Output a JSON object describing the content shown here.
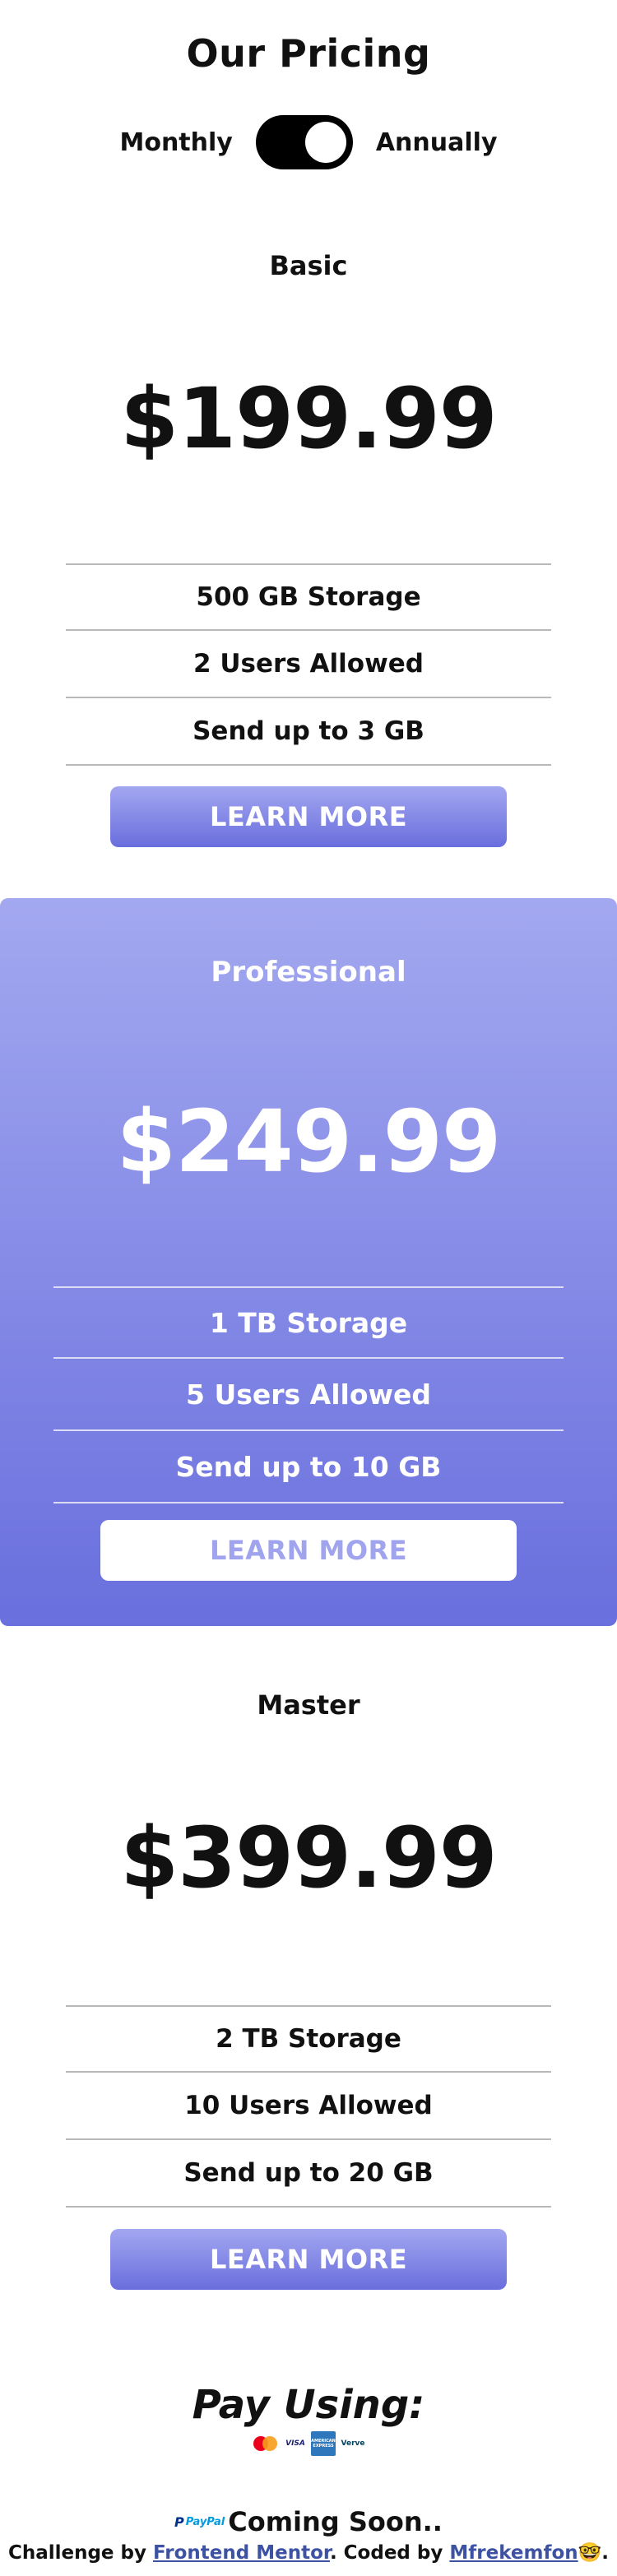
{
  "header": {
    "title": "Our Pricing",
    "toggle": {
      "left_label": "Monthly",
      "right_label": "Annually",
      "state": "annually"
    }
  },
  "plans": [
    {
      "name": "Basic",
      "price": "$199.99",
      "features": [
        "500 GB Storage",
        "2 Users Allowed",
        "Send up to 3 GB"
      ],
      "button_label": "LEARN MORE"
    },
    {
      "name": "Professional",
      "price": "$249.99",
      "features": [
        "1 TB Storage",
        "5 Users Allowed",
        "Send up to 10 GB"
      ],
      "button_label": "LEARN MORE"
    },
    {
      "name": "Master",
      "price": "$399.99",
      "features": [
        "2 TB Storage",
        "10 Users Allowed",
        "Send up to 20 GB"
      ],
      "button_label": "LEARN MORE"
    }
  ],
  "payment": {
    "title": "Pay Using:",
    "methods": [
      {
        "icon": "mastercard-icon",
        "label": ""
      },
      {
        "icon": "visa-icon",
        "label": "VISA"
      },
      {
        "icon": "amex-icon",
        "label": "AMERICAN EXPRESS"
      },
      {
        "icon": "verve-icon",
        "label": "Verve"
      }
    ],
    "paypal_label": "PayPal",
    "coming_soon": "Coming Soon.."
  },
  "footer": {
    "prefix": "Challenge by ",
    "challenge_link": "Frontend Mentor",
    "middle": ". Coded by ",
    "author_link": "Mfrekemfon",
    "emoji": "🤓",
    "suffix": "."
  },
  "colors": {
    "accent_top": "#a3a7f0",
    "accent_bottom": "#696edd",
    "text": "#111111",
    "link": "#3e52a3"
  }
}
